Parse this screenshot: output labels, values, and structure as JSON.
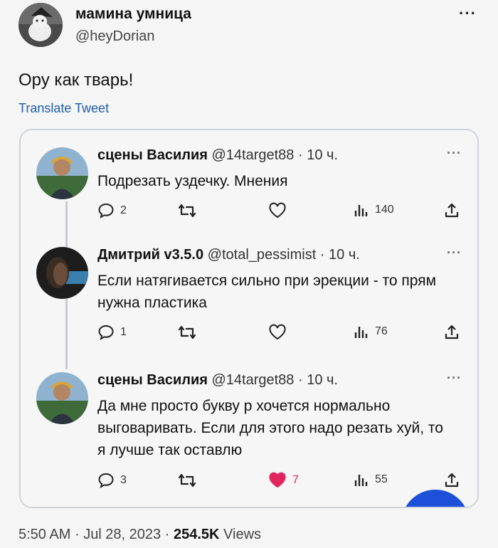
{
  "tweet": {
    "author_name": "мамина умница",
    "author_handle": "@heyDorian",
    "text": "Ору как тварь!",
    "translate_label": "Translate Tweet",
    "more_label": "···",
    "time": "5:50 AM",
    "date": "Jul 28, 2023",
    "views_count": "254.5K",
    "views_label": "Views",
    "separator": "·"
  },
  "quoted_thread": [
    {
      "name": "сцены Василия",
      "handle_time": "@14target88 · 10 ч.",
      "text": "Подрезать уздечку. Мнения",
      "more": "···",
      "replies": "2",
      "retweets": "",
      "likes": "",
      "views": "140",
      "liked": false
    },
    {
      "name": "Дмитрий v3.5.0",
      "handle_time": "@total_pessimist · 10 ч.",
      "text": "Если натягивается сильно при эрекции - то прям нужна пластика",
      "more": "···",
      "replies": "1",
      "retweets": "",
      "likes": "",
      "views": "76",
      "liked": false
    },
    {
      "name": "сцены Василия",
      "handle_time": "@14target88 · 10 ч.",
      "text": "Да мне просто букву р хочется нормально выговаривать. Если для этого надо резать хуй, то я лучше так оставлю",
      "more": "···",
      "replies": "3",
      "retweets": "",
      "likes": "7",
      "views": "55",
      "liked": true
    }
  ],
  "colors": {
    "like_active": "#e0245e",
    "link": "#1d5ea8",
    "compose_button": "#1d4fd8"
  },
  "icons": [
    "reply-icon",
    "retweet-icon",
    "like-icon",
    "views-icon",
    "share-icon",
    "more-icon"
  ]
}
